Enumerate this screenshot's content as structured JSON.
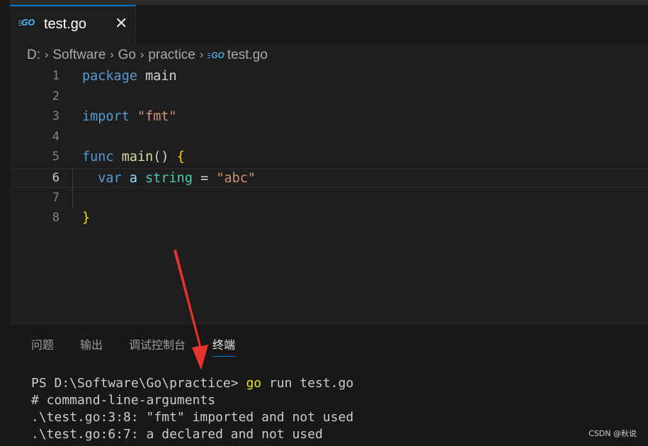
{
  "tab": {
    "icon": "GO",
    "label": "test.go",
    "close": "✕"
  },
  "breadcrumb": {
    "items": [
      "D:",
      "Software",
      "Go",
      "practice"
    ],
    "file_icon": "GO",
    "file": "test.go",
    "separator": "›"
  },
  "editor": {
    "current_line": 6,
    "lines": [
      {
        "n": "1",
        "tokens": [
          {
            "t": "package",
            "c": "kw"
          },
          {
            "t": " main",
            "c": "plain"
          }
        ]
      },
      {
        "n": "2",
        "tokens": []
      },
      {
        "n": "3",
        "tokens": [
          {
            "t": "import",
            "c": "kw"
          },
          {
            "t": " ",
            "c": "plain"
          },
          {
            "t": "\"fmt\"",
            "c": "str"
          }
        ]
      },
      {
        "n": "4",
        "tokens": []
      },
      {
        "n": "5",
        "tokens": [
          {
            "t": "func",
            "c": "kw"
          },
          {
            "t": " ",
            "c": "plain"
          },
          {
            "t": "main",
            "c": "fn"
          },
          {
            "t": "() ",
            "c": "plain"
          },
          {
            "t": "{",
            "c": "brace"
          }
        ]
      },
      {
        "n": "6",
        "tokens": [
          {
            "t": "  ",
            "c": "plain"
          },
          {
            "t": "var",
            "c": "kw"
          },
          {
            "t": " ",
            "c": "plain"
          },
          {
            "t": "a",
            "c": "var"
          },
          {
            "t": " ",
            "c": "plain"
          },
          {
            "t": "string",
            "c": "ty"
          },
          {
            "t": " = ",
            "c": "plain"
          },
          {
            "t": "\"abc\"",
            "c": "str"
          }
        ]
      },
      {
        "n": "7",
        "tokens": []
      },
      {
        "n": "8",
        "tokens": [
          {
            "t": "}",
            "c": "brace"
          }
        ]
      }
    ]
  },
  "panel": {
    "tabs": [
      {
        "label": "问题",
        "active": false
      },
      {
        "label": "输出",
        "active": false
      },
      {
        "label": "调试控制台",
        "active": false
      },
      {
        "label": "终端",
        "active": true
      }
    ]
  },
  "terminal": {
    "prompt": "PS D:\\Software\\Go\\practice> ",
    "cmd_go": "go",
    "cmd_rest": " run test.go",
    "output": [
      "# command-line-arguments",
      ".\\test.go:3:8: \"fmt\" imported and not used",
      ".\\test.go:6:7: a declared and not used"
    ]
  },
  "watermark": "CSDN @秋说",
  "colors": {
    "background": "#1e1e1e",
    "keyword": "#569cd6",
    "string": "#ce9178",
    "type": "#4ec9b0",
    "function": "#dcdcaa",
    "accent": "#0078d4",
    "arrow": "#e8322b"
  }
}
